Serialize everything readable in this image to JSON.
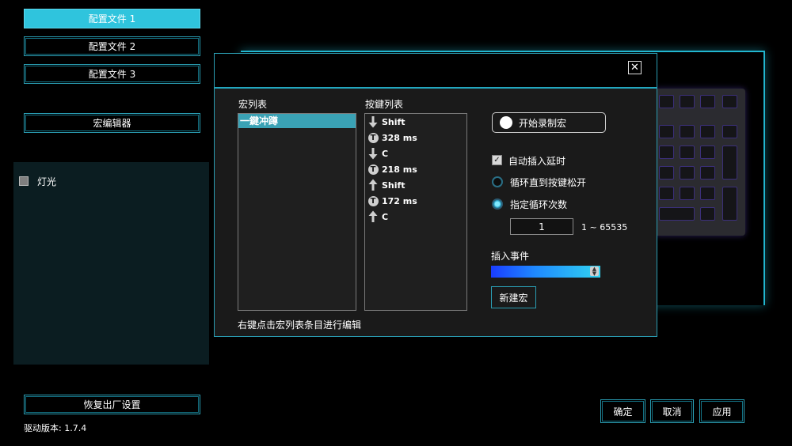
{
  "sidebar": {
    "profiles": [
      "配置文件 1",
      "配置文件 2",
      "配置文件 3"
    ],
    "macro_editor": "宏编辑器",
    "lighting_label": "灯光",
    "reset": "恢复出厂设置",
    "version_label": "驱动版本:",
    "version_value": "1.7.4"
  },
  "dialog": {
    "close_symbol": "✕",
    "macro_list_label": "宏列表",
    "macro_items": [
      "一鍵冲蹲"
    ],
    "key_list_label": "按鍵列表",
    "key_items": [
      {
        "icon": "arrow-down-icon",
        "text": "Shift"
      },
      {
        "icon": "timer-icon",
        "text": "328 ms"
      },
      {
        "icon": "arrow-down-icon",
        "text": "C"
      },
      {
        "icon": "timer-icon",
        "text": "218 ms"
      },
      {
        "icon": "arrow-up-icon",
        "text": "Shift"
      },
      {
        "icon": "timer-icon",
        "text": "172 ms"
      },
      {
        "icon": "arrow-up-icon",
        "text": "C"
      }
    ],
    "timer_glyph": "T",
    "record_label": "开始录制宏",
    "auto_delay_label": "自动插入延时",
    "auto_delay_checked": true,
    "loop_until_release_label": "循环直到按键松开",
    "loop_count_label": "指定循环次数",
    "selected_loop_mode": "count",
    "loop_count_value": "1",
    "loop_range": "1 ~ 65535",
    "insert_event_label": "插入事件",
    "new_macro_label": "新建宏",
    "hint": "右键点击宏列表条目进行编辑"
  },
  "footer": {
    "ok": "确定",
    "cancel": "取消",
    "apply": "应用"
  },
  "colors": {
    "accent": "#2fc4dd",
    "border": "#2a9db2",
    "selection": "#3aa2b5"
  }
}
